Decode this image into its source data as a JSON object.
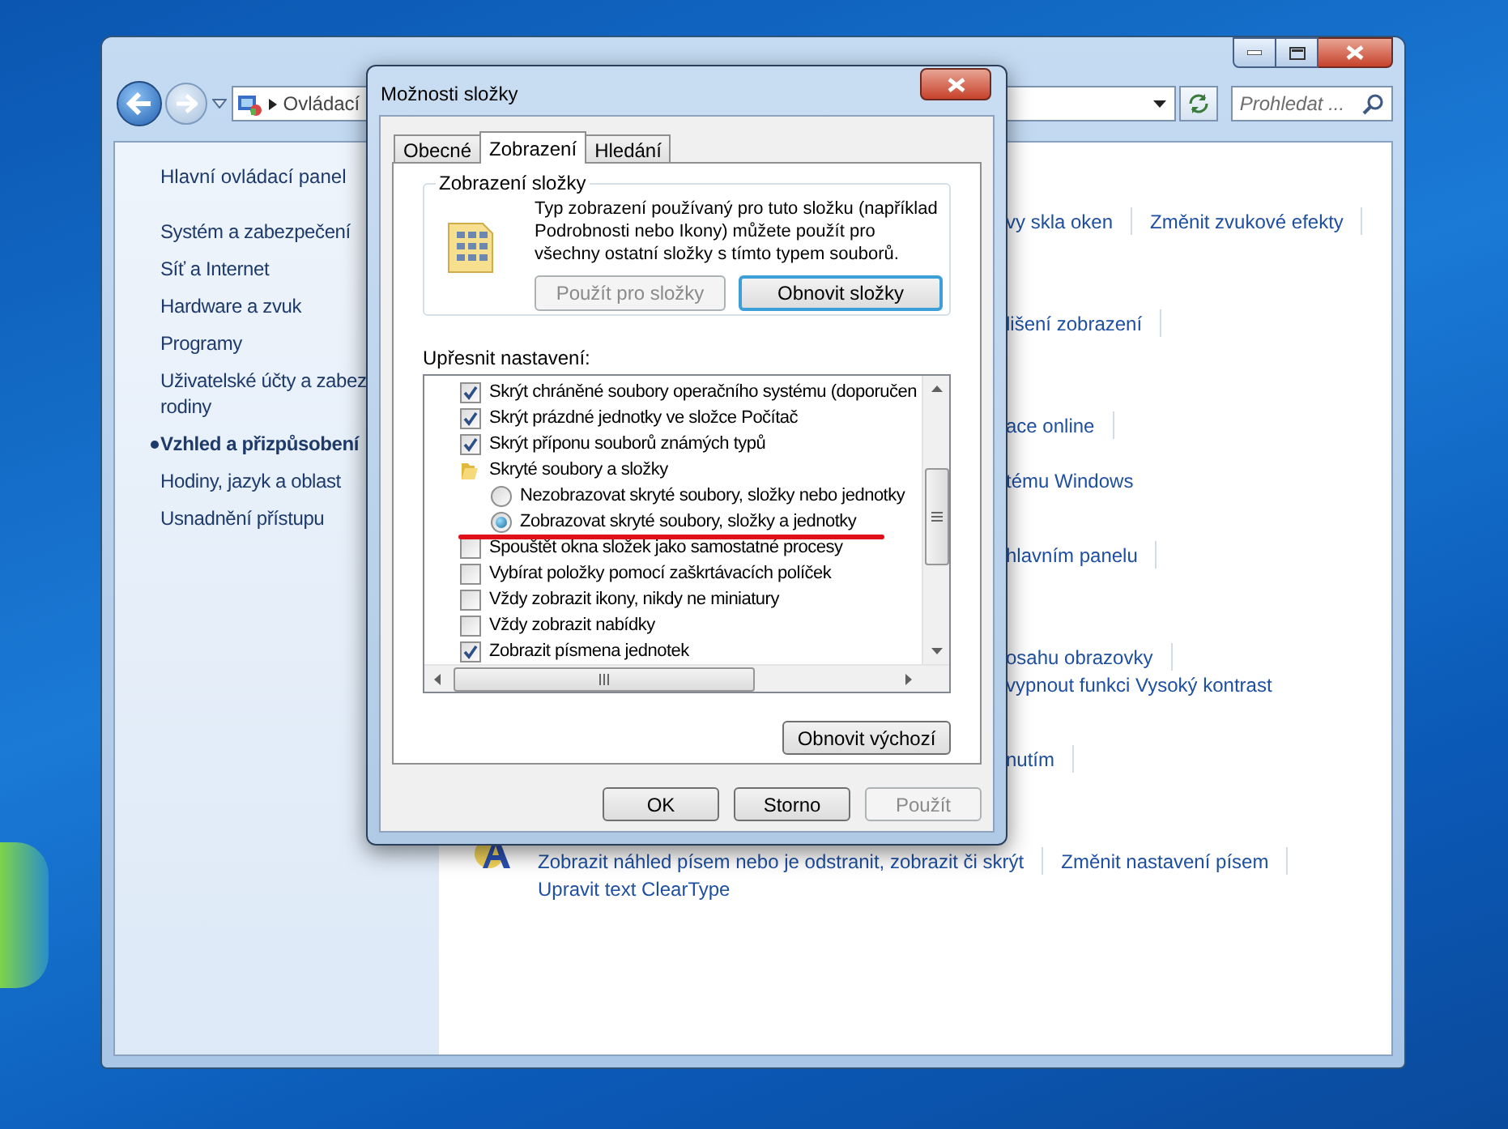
{
  "explorer": {
    "address": {
      "text": "Ovládací"
    },
    "search": {
      "placeholder": "Prohledat ..."
    },
    "sidebar": {
      "home": "Hlavní ovládací panel",
      "items": [
        {
          "lines": [
            "Systém a zabezpečení"
          ],
          "selected": false
        },
        {
          "lines": [
            "Síť a Internet"
          ],
          "selected": false
        },
        {
          "lines": [
            "Hardware a zvuk"
          ],
          "selected": false
        },
        {
          "lines": [
            "Programy"
          ],
          "selected": false
        },
        {
          "lines": [
            "Uživatelské účty a zabez",
            "rodiny"
          ],
          "selected": false
        },
        {
          "lines": [
            "Vzhled a přizpůsobení"
          ],
          "selected": true
        },
        {
          "lines": [
            "Hodiny, jazyk a oblast"
          ],
          "selected": false
        },
        {
          "lines": [
            "Usnadnění přístupu"
          ],
          "selected": false
        }
      ]
    },
    "link_groups": [
      {
        "lines": [
          [
            "vy skla oken",
            "Změnit zvukové efekty"
          ]
        ]
      },
      {
        "lines": [
          [
            "lišení zobrazení"
          ]
        ]
      },
      {
        "lines": [
          [
            "ace online"
          ],
          [
            "tému Windows"
          ]
        ]
      },
      {
        "lines": [
          [
            "hlavním panelu"
          ]
        ]
      },
      {
        "lines": [
          [
            "osahu obrazovky"
          ],
          [
            "vypnout funkci Vysoký kontrast"
          ]
        ]
      },
      {
        "lines": [
          [
            "nutím"
          ]
        ]
      },
      {
        "lines": [
          [
            "Zobrazit náhled písem nebo je odstranit, zobrazit či skrýt",
            "Změnit nastavení písem"
          ],
          [
            "Upravit text ClearType"
          ]
        ]
      }
    ]
  },
  "dialog": {
    "title": "Možnosti složky",
    "tabs": [
      {
        "label": "Obecné",
        "selected": false
      },
      {
        "label": "Zobrazení",
        "selected": true
      },
      {
        "label": "Hledání",
        "selected": false
      }
    ],
    "folder_views": {
      "title": "Zobrazení složky",
      "description": "Typ zobrazení používaný pro tuto složku (například Podrobnosti nebo Ikony) můžete použít pro všechny ostatní složky s tímto typem souborů.",
      "buttons": [
        {
          "label": "Použít pro složky",
          "disabled": true,
          "default": false
        },
        {
          "label": "Obnovit složky",
          "disabled": false,
          "default": true
        }
      ]
    },
    "advanced_label": "Upřesnit nastavení:",
    "advanced_settings": [
      {
        "kind": "checkbox",
        "label": "Skrýt chráněné soubory operačního systému (doporučen",
        "checked": true
      },
      {
        "kind": "checkbox",
        "label": "Skrýt prázdné jednotky ve složce Počítač",
        "checked": true
      },
      {
        "kind": "checkbox",
        "label": "Skrýt příponu souborů známých typů",
        "checked": true
      },
      {
        "kind": "folder",
        "label": "Skryté soubory a složky",
        "children": [
          {
            "kind": "radio",
            "label": "Nezobrazovat skryté soubory, složky nebo jednotky",
            "selected": false
          },
          {
            "kind": "radio",
            "label": "Zobrazovat skryté soubory, složky a jednotky",
            "selected": true
          }
        ]
      },
      {
        "kind": "checkbox",
        "label": "Spouštět okna složek jako samostatné procesy",
        "checked": false
      },
      {
        "kind": "checkbox",
        "label": "Vybírat položky pomocí zaškrtávacích políček",
        "checked": false
      },
      {
        "kind": "checkbox",
        "label": "Vždy zobrazit ikony, nikdy ne miniatury",
        "checked": false
      },
      {
        "kind": "checkbox",
        "label": "Vždy zobrazit nabídky",
        "checked": false
      },
      {
        "kind": "checkbox",
        "label": "Zobrazit písmena jednotek",
        "checked": true
      }
    ],
    "restore_defaults_button": "Obnovit výchozí",
    "buttons": [
      {
        "label": "OK",
        "disabled": false
      },
      {
        "label": "Storno",
        "disabled": false
      },
      {
        "label": "Použít",
        "disabled": true
      }
    ]
  }
}
